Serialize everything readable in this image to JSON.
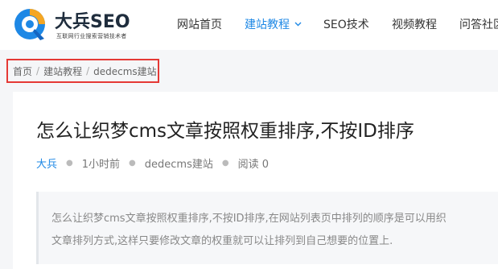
{
  "logo": {
    "title": "大兵SEO",
    "subtitle": "互联网行业搜索营销技术者",
    "colors": {
      "q_outer": "#1e88e5",
      "q_accent": "#f5a623",
      "q_center": "#ffffff"
    }
  },
  "nav": {
    "items": [
      {
        "label": "网站首页",
        "active": false
      },
      {
        "label": "建站教程",
        "active": true,
        "has_dropdown": true
      },
      {
        "label": "SEO技术",
        "active": false
      },
      {
        "label": "视频教程",
        "active": false
      },
      {
        "label": "问答社区",
        "active": false
      }
    ],
    "active_color": "#1e88e5"
  },
  "breadcrumb": {
    "items": [
      "首页",
      "建站教程",
      "dedecms建站"
    ],
    "separator": "/",
    "highlight_color": "#e53935"
  },
  "article": {
    "title": "怎么让织梦cms文章按照权重排序,不按ID排序",
    "author": "大兵",
    "time": "1小时前",
    "category": "dedecms建站",
    "views": "阅读 0",
    "summary_lines": [
      "怎么让织梦cms文章按照权重排序,不按ID排序,在网站列表页中排列的顺序是可以用织",
      "文章排列方式,这样只要修改文章的权重就可以让排列到自己想要的位置上."
    ]
  }
}
